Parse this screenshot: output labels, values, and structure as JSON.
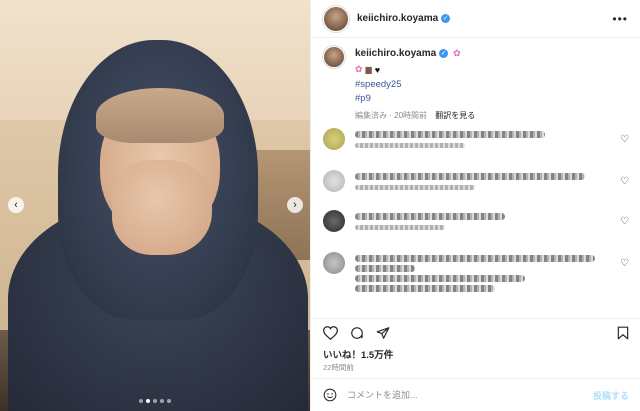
{
  "post": {
    "username": "keiichiro.koyama",
    "verified_icon": "verified-badge-icon",
    "more_icon": "more-options-icon",
    "carousel": {
      "total_slides": 5,
      "active_slide": 2
    }
  },
  "caption": {
    "username": "keiichiro.koyama",
    "emoji_line": [
      "flower-emoji",
      "bag-emoji",
      "black-heart-emoji"
    ],
    "hashtags": [
      "#speedy25",
      "#p9"
    ],
    "edited_label": "編集済み",
    "separator": "·",
    "age": "20時間前",
    "see_translation": "翻訳を見る"
  },
  "comments": [
    {
      "id": "c1",
      "avatar_color": "#c8c26a",
      "blurred": true
    },
    {
      "id": "c2",
      "avatar_color": "#bdbdbd",
      "blurred": true
    },
    {
      "id": "c3",
      "avatar_color": "#4a4a4a",
      "blurred": true
    },
    {
      "id": "c4",
      "avatar_color": "#9a9a9a",
      "blurred": true
    }
  ],
  "actions": {
    "like_icon": "heart-icon",
    "comment_icon": "comment-icon",
    "share_icon": "share-icon",
    "save_icon": "bookmark-icon"
  },
  "likes_text": "いいね！1.5万件",
  "timestamp": "22時間前",
  "comment_input": {
    "placeholder": "コメントを追加...",
    "post_label": "投稿する",
    "emoji_icon": "smile-icon"
  }
}
